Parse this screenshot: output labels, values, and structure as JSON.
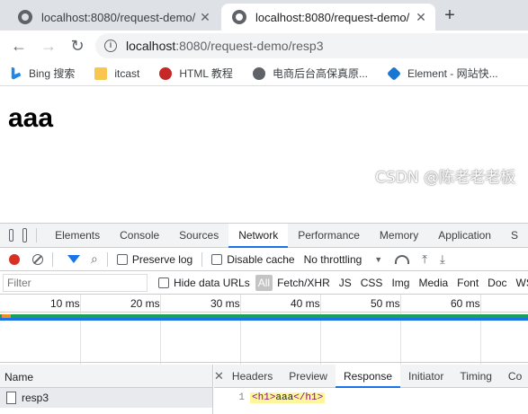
{
  "browser": {
    "tabs": [
      {
        "title": "localhost:8080/request-demo/",
        "close": "✕"
      },
      {
        "title": "localhost:8080/request-demo/",
        "close": "✕"
      }
    ],
    "new_tab": "+",
    "url_host": "localhost",
    "url_rest": ":8080/request-demo/resp3",
    "bookmarks": [
      {
        "label": "Bing 搜索",
        "icon": "bing-icon"
      },
      {
        "label": "itcast",
        "icon": "folder-icon"
      },
      {
        "label": "HTML 教程",
        "icon": "html-icon"
      },
      {
        "label": "电商后台高保真原...",
        "icon": "globe-icon"
      },
      {
        "label": "Element - 网站快...",
        "icon": "element-icon"
      }
    ]
  },
  "page": {
    "heading": "aaa"
  },
  "devtools": {
    "tabs": [
      "Elements",
      "Console",
      "Sources",
      "Network",
      "Performance",
      "Memory",
      "Application",
      "S"
    ],
    "active_tab": "Network",
    "toolbar": {
      "preserve_log": "Preserve log",
      "disable_cache": "Disable cache",
      "throttling": "No throttling"
    },
    "filter": {
      "placeholder": "Filter",
      "hide_data_urls": "Hide data URLs",
      "types": [
        "All",
        "Fetch/XHR",
        "JS",
        "CSS",
        "Img",
        "Media",
        "Font",
        "Doc",
        "WS"
      ]
    },
    "timeline_ticks": [
      "10 ms",
      "20 ms",
      "30 ms",
      "40 ms",
      "50 ms",
      "60 ms"
    ],
    "requests": {
      "name_header": "Name",
      "rows": [
        "resp3"
      ]
    },
    "detail_tabs": [
      "Headers",
      "Preview",
      "Response",
      "Initiator",
      "Timing",
      "Co"
    ],
    "active_detail_tab": "Response",
    "response": {
      "line_number": "1",
      "open_tag": "<h1>",
      "text": "aaa",
      "close_tag": "</h1>"
    }
  },
  "watermark": "CSDN @陈老老老板",
  "colors": {
    "accent": "#1a73e8",
    "record": "#d93025",
    "timeline_green": "#1a9f54",
    "highlight": "#fff59d"
  }
}
